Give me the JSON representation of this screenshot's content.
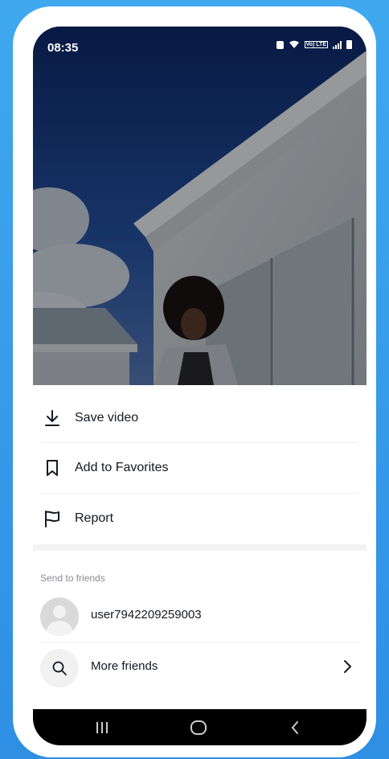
{
  "status_bar": {
    "time": "08:35",
    "icons": [
      "lock-icon",
      "wifi-icon",
      "volte-icon",
      "signal-icon",
      "battery-icon"
    ],
    "lte_label": "Vo) LTE"
  },
  "menu": {
    "save_video": "Save video",
    "add_to_favorites": "Add to Favorites",
    "report": "Report"
  },
  "share": {
    "section_title": "Send to friends",
    "friends": [
      {
        "username": "user7942209259003"
      }
    ],
    "more_friends": "More friends"
  },
  "colors": {
    "background": "#3fa8ef",
    "sheet": "#ffffff",
    "text": "#161823",
    "muted": "#8a8b91",
    "navbar": "#000000"
  }
}
